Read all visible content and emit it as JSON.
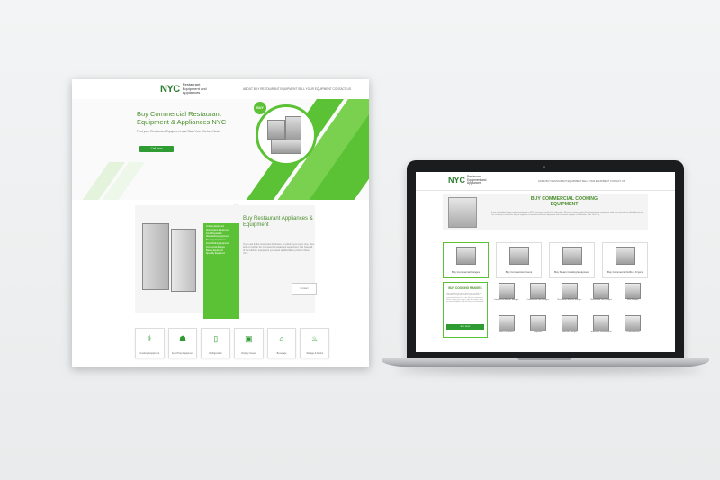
{
  "poster": {
    "logo_mark": "NYC",
    "logo_text": "Restaurant Equipment and Appliances",
    "menu": "ABOUT   BUY RESTAURANT EQUIPMENT   SELL YOUR EQUIPMENT   CONTACT US",
    "hero_title": "Buy Commercial Restaurant Equipment & Appliances NYC",
    "hero_sub": "Find your Restaurant Equipment and Start Your Kitchen Now!",
    "hero_button": "Call Now",
    "hero_badge": "BUY",
    "carousel_dots": "• •",
    "section_title": "Buy Restaurant Appliances & Equipment",
    "section_text": "If you are in the restaurant business, or planning to open one, then look no further for commercial restaurant equipment. We have all of the kitchen equipment you need at affordable prices in New York.",
    "list_items": [
      "Cooking Equipment",
      "Refrigeration Equipment",
      "Food Preparation",
      "Warewashing Equipment",
      "Beverage Equipment",
      "Food Holding Equipment",
      "Commercial Ranges",
      "Bakery Equipment",
      "Specialty Equipment"
    ],
    "section_button": "Contact",
    "icons": [
      {
        "icon": "chef-icon",
        "glyph": "⚕",
        "label": "Cooking Equipment"
      },
      {
        "icon": "prep-icon",
        "glyph": "☗",
        "label": "Food Prep Equipment"
      },
      {
        "icon": "fridge-icon",
        "glyph": "▯",
        "label": "Refrigeration"
      },
      {
        "icon": "display-icon",
        "glyph": "▣",
        "label": "Display Cases"
      },
      {
        "icon": "sink-icon",
        "glyph": "⌂",
        "label": "Beverage"
      },
      {
        "icon": "cart-icon",
        "glyph": "♨",
        "label": "Storage & Racks"
      }
    ]
  },
  "laptop": {
    "logo_mark": "NYC",
    "logo_text": "Restaurant Equipment and Appliances",
    "menu": "HOME   BUY RESTAURANT EQUIPMENT   SELL YOUR EQUIPMENT   CONTACT US",
    "hero_title": "BUY COMMERCIAL COOKING EQUIPMENT",
    "hero_text": "If you are looking to buy cooking equipment in NYC, you have arrived at the right place. We have a huge variety of food preparation equipment, both new and used at affordable prices. Our company is one of the largest suppliers of commercial kitchen equipment and restaurant supplies in Manhattan, New York City.",
    "cards": [
      {
        "label": "Buy Commercial Ranges"
      },
      {
        "label": "Buy Commercial Ovens"
      },
      {
        "label": "Buy Steam Cooking Equipment"
      },
      {
        "label": "Buy Commercial Grills & Fryers"
      }
    ],
    "range_title": "BUY COOKING RANGES",
    "range_text": "Our company is the place where you can find any commercial range you need for your business: restaurant, food truck or cafe. We offer commercial electric ranges, gas ranges, induction ranges, stock pot stoves, hotplates and wok burners at reasonable prices.",
    "range_button": "BUY NOW",
    "grid": [
      "Commercial Electric Ranges",
      "Commercial Gas Ranges",
      "Restaurant Electric Ranges",
      "Restaurant Gas Ranges",
      "Wok Ranges",
      "Stock Pot Stoves",
      "Hotplates",
      "Induction Ranges",
      "Broilers & Salamanders",
      "Cheesemelters"
    ]
  },
  "colors": {
    "brand_green": "#5cc235",
    "dark_green": "#2e9c32",
    "title_green": "#4a8f2c"
  }
}
